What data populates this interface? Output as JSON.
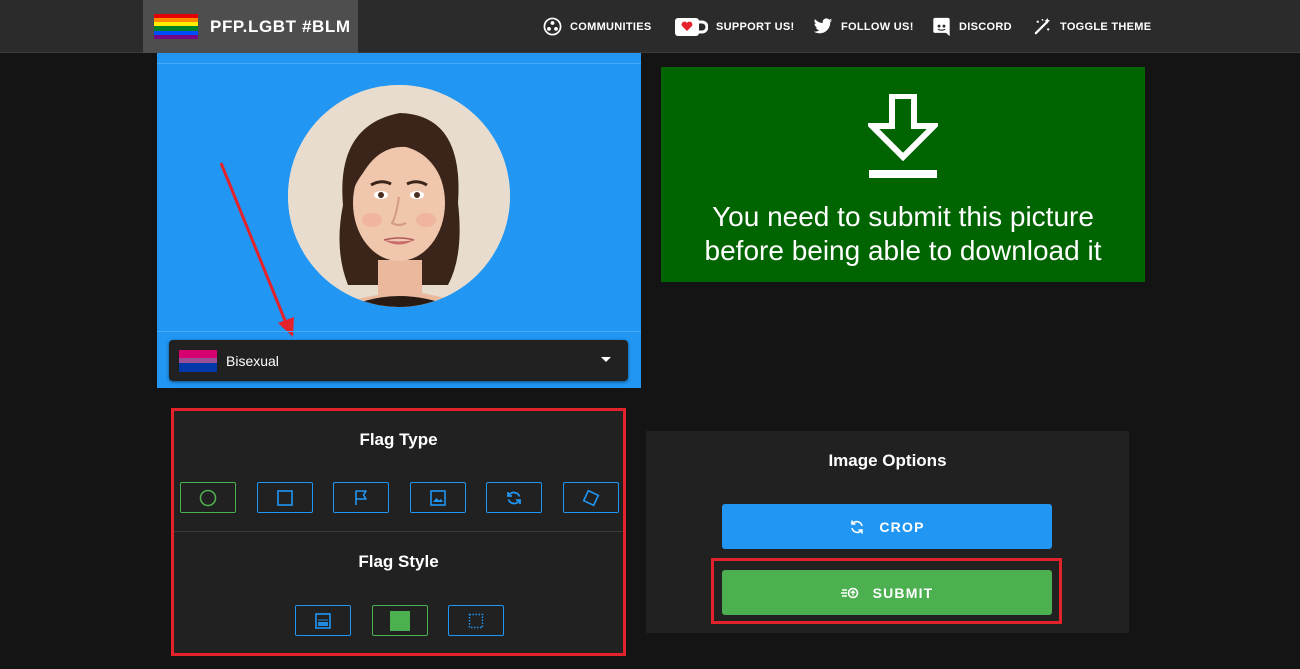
{
  "header": {
    "brand_title": "PFP.LGBT #BLM",
    "rainbow_colors": [
      "#e40303",
      "#ff8c00",
      "#ffed00",
      "#008026",
      "#004dff",
      "#750787"
    ],
    "nav": [
      {
        "label": "COMMUNITIES",
        "icon": "communities-icon"
      },
      {
        "label": "SUPPORT US!",
        "icon": "ko-fi-cup-icon"
      },
      {
        "label": "FOLLOW US!",
        "icon": "twitter-bird-icon"
      },
      {
        "label": "DISCORD",
        "icon": "discord-icon"
      },
      {
        "label": "TOGGLE THEME",
        "icon": "theme-toggle-icon"
      }
    ]
  },
  "preview": {
    "flag_select": {
      "value": "Bisexual",
      "flag_colors": [
        "#d60270",
        "#9b4f96",
        "#0038a8"
      ]
    }
  },
  "download_notice": {
    "text_line1": "You need to submit this picture",
    "text_line2": "before being able to download it",
    "background": "#006400"
  },
  "flag_type": {
    "heading": "Flag Type",
    "options": [
      "circle-icon",
      "square-icon",
      "flag-icon",
      "image-icon",
      "rotate-icon",
      "diamond-icon"
    ],
    "selected": "circle-icon"
  },
  "flag_style": {
    "heading": "Flag Style",
    "options": [
      "gradient-icon",
      "solid-square-icon",
      "dotted-square-icon"
    ],
    "selected": "solid-square-icon"
  },
  "image_options": {
    "heading": "Image Options",
    "crop_label": "CROP",
    "submit_label": "SUBMIT"
  },
  "colors": {
    "accent_blue": "#2196f3",
    "accent_green": "#4caf50",
    "highlight_red": "#e3222b"
  }
}
